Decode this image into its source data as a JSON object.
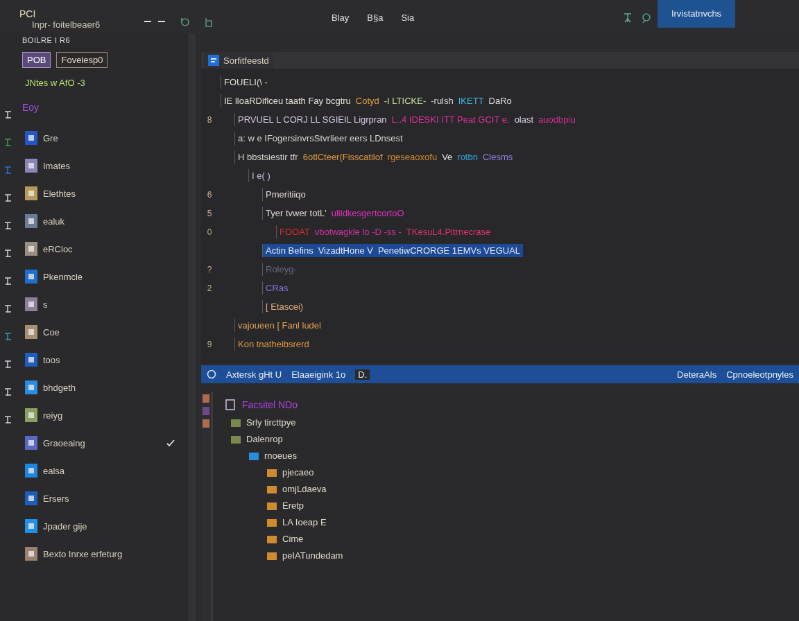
{
  "titlebar": {
    "app_label": "PCI",
    "subtitle": "Inpr- foitelbeaer6",
    "menu": [
      "Blay",
      "B§a",
      "Sia"
    ],
    "action_button": "Irvistatnvchs"
  },
  "sidebar": {
    "header": "BOILRE I R6",
    "tabs": [
      {
        "label": "POB",
        "selected": true
      },
      {
        "label": "Fovelesp0",
        "selected": false
      }
    ],
    "filter": "JNtes w AfO -3",
    "section": "Eoy",
    "items": [
      {
        "label": "Gre",
        "color": "#2456c8",
        "checked": false
      },
      {
        "label": "Imates",
        "color": "#8a86b8",
        "checked": false
      },
      {
        "label": "Elethtes",
        "color": "#b89a5a",
        "checked": false
      },
      {
        "label": "ealuk",
        "color": "#6f7a9a",
        "checked": false
      },
      {
        "label": "eRCloc",
        "color": "#9a8f80",
        "checked": false
      },
      {
        "label": "Pkenmcle",
        "color": "#1e6fd0",
        "checked": false
      },
      {
        "label": "s",
        "color": "#8c7f9a",
        "checked": false
      },
      {
        "label": "Coe",
        "color": "#a89070",
        "checked": false
      },
      {
        "label": "toos",
        "color": "#1d5fc0",
        "checked": false
      },
      {
        "label": "bhdgeth",
        "color": "#2a8ee0",
        "checked": false
      },
      {
        "label": "reiyg",
        "color": "#8aa060",
        "checked": false
      },
      {
        "label": "Graoeaing",
        "color": "#5a6ac0",
        "checked": true
      },
      {
        "label": "ealsa",
        "color": "#1c86e0",
        "checked": false
      },
      {
        "label": "Ersers",
        "color": "#1a5fb8",
        "checked": false
      },
      {
        "label": "Jpader gije",
        "color": "#2090e8",
        "checked": false
      },
      {
        "label": "Bexto Inrxe erfeturg",
        "color": "#9a8070",
        "checked": false
      }
    ]
  },
  "editor": {
    "tab": {
      "label": "Sorfitfeestd"
    },
    "lines": [
      {
        "selected": false,
        "segments": [
          {
            "text": "FOUELI(\\ -",
            "color": "#e0dcd0"
          }
        ]
      },
      {
        "selected": false,
        "segments": [
          {
            "text": "IE lloaRDiflceu taath Fay bcgtru",
            "color": "#e6e2d6"
          },
          {
            "text": "Cotyd",
            "color": "#e0a040"
          },
          {
            "text": "-I LTICKE-",
            "color": "#c8e0a0"
          },
          {
            "text": "-rulsh",
            "color": "#d8d8d8"
          },
          {
            "text": "IKETT",
            "color": "#40b8e8"
          },
          {
            "text": "DaRo",
            "color": "#e0e0e0"
          }
        ],
        "children": [
          {
            "gutter": "8",
            "selected": false,
            "segments": [
              {
                "text": "PRVUEL L CORJ LL SGIEIL Ligrpran",
                "color": "#d8c8e8"
              },
              {
                "text": "L..4 IDESKI ITT Peat GCIT e.",
                "color": "#e0309a"
              },
              {
                "text": "olast",
                "color": "#d8d0e8"
              },
              {
                "text": "auodbpiu",
                "color": "#d0309a"
              }
            ]
          },
          {
            "selected": false,
            "segments": [
              {
                "text": "a: w e IFogersinvrsStvrlieer eers LDnsest",
                "color": "#d8d4cc"
              }
            ]
          },
          {
            "selected": false,
            "segments": [
              {
                "text": "H bbstsiestir tfr",
                "color": "#d8d4cc"
              },
              {
                "text": "6otlCteer(Fisscatilof",
                "color": "#e09a40"
              },
              {
                "text": "rgeseaoxofu",
                "color": "#d08a30"
              },
              {
                "text": "Ve",
                "color": "#e0e0e0"
              },
              {
                "text": "rotbn",
                "color": "#30a8e0"
              },
              {
                "text": "Clesms",
                "color": "#9080e0"
              }
            ],
            "children": [
              {
                "selected": false,
                "segments": [
                  {
                    "text": "I e( )",
                    "color": "#c8c0d8"
                  }
                ],
                "children": [
                  {
                    "gutter": "6",
                    "selected": false,
                    "segments": [
                      {
                        "text": "Pmeritiiqo",
                        "color": "#e0d8d0"
                      }
                    ]
                  },
                  {
                    "gutter": "5",
                    "selected": false,
                    "segments": [
                      {
                        "text": "Tyer tvwer totL'",
                        "color": "#e0d8d0"
                      },
                      {
                        "text": "ulildkesgertcortoO",
                        "color": "#e030c0"
                      }
                    ],
                    "children": [
                      {
                        "gutter": "0",
                        "selected": false,
                        "segments": [
                          {
                            "text": "FOOAT",
                            "color": "#e02830"
                          },
                          {
                            "text": "vbotwagkle lo -D -ss -",
                            "color": "#d030a0"
                          },
                          {
                            "text": "TKesuL4.Pitrnecrase",
                            "color": "#e03070"
                          }
                        ]
                      }
                    ]
                  },
                  {
                    "selected": true,
                    "segments": [
                      {
                        "text": "Actin Befins",
                        "color": "#e8e8f8"
                      },
                      {
                        "text": "VizadtHone V",
                        "color": "#e8e8f8"
                      },
                      {
                        "text": "PenetiwCRORGE 1EMVs VEGUAL",
                        "color": "#e8e8f8"
                      }
                    ]
                  },
                  {
                    "gutter": "?",
                    "selected": false,
                    "segments": [
                      {
                        "text": "Roleyg-",
                        "color": "#6a6480"
                      }
                    ]
                  },
                  {
                    "gutter": "2",
                    "selected": false,
                    "segments": [
                      {
                        "text": "CRas",
                        "color": "#8870d8"
                      }
                    ]
                  },
                  {
                    "selected": false,
                    "segments": [
                      {
                        "text": "[ Etascei)",
                        "color": "#e0b080"
                      }
                    ]
                  }
                ]
              }
            ]
          },
          {
            "selected": false,
            "segments": [
              {
                "text": "vajoueen [ Fanl ludel",
                "color": "#e0a050"
              }
            ]
          },
          {
            "gutter": "9",
            "selected": false,
            "segments": [
              {
                "text": "Kon tnatheibsrerd",
                "color": "#e09a40"
              }
            ]
          }
        ]
      }
    ],
    "status_bar": {
      "left": [
        "Axtersk gHt U",
        "Elaaeigink 1o",
        "D."
      ],
      "right": [
        "DeteraAls",
        "Cpnoeleotpnyles"
      ]
    },
    "panel": {
      "title": "Facsitel NDo",
      "tree": [
        {
          "label": "Srly tircttpye"
        },
        {
          "label": "Dalenrop",
          "children": [
            {
              "label": "rnoeues",
              "children": [
                {
                  "label": "pjecaeo"
                },
                {
                  "label": "omjLdaeva"
                },
                {
                  "label": "Eretp"
                },
                {
                  "label": "LA Ioeap E"
                },
                {
                  "label": "Cime"
                },
                {
                  "label": "peIATundedam"
                }
              ]
            }
          ]
        }
      ]
    }
  }
}
